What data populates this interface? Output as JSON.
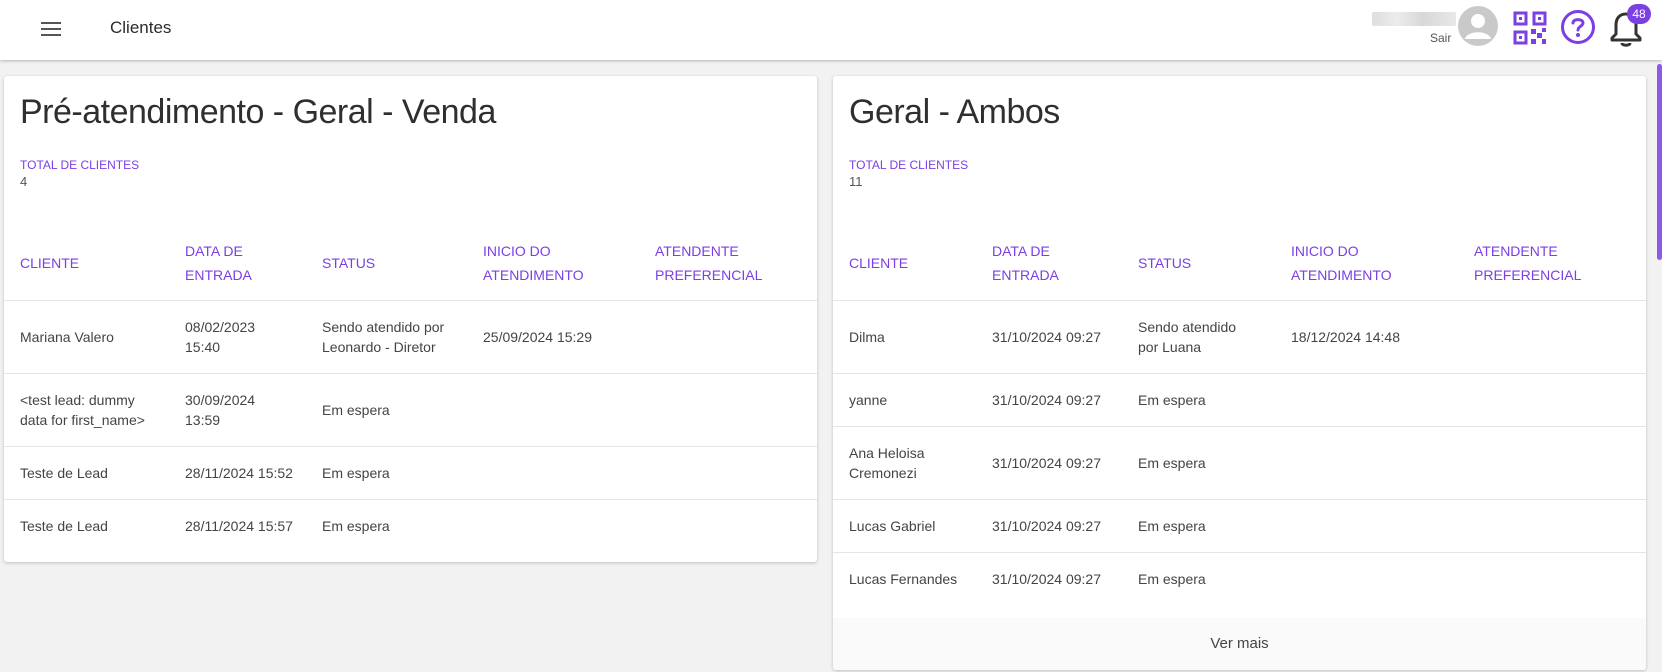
{
  "header": {
    "title": "Clientes",
    "logout": "Sair",
    "notification_count": "48",
    "accent_color": "#7b3fe4",
    "icons": [
      "menu-icon",
      "avatar-icon",
      "qr-code-icon",
      "help-icon",
      "bell-icon"
    ]
  },
  "left": {
    "title": "Pré-atendimento - Geral - Venda",
    "total_label": "TOTAL DE CLIENTES",
    "total_value": "4",
    "columns": [
      "CLIENTE",
      "DATA DE ENTRADA",
      "STATUS",
      "INICIO DO ATENDIMENTO",
      "ATENDENTE PREFERENCIAL"
    ],
    "rows": [
      {
        "cliente": "Mariana Valero",
        "data": "08/02/2023 15:40",
        "status": "Sendo atendido por Leonardo - Diretor",
        "inicio": "25/09/2024 15:29",
        "atendente": ""
      },
      {
        "cliente": "<test lead: dummy data for first_name>",
        "data": "30/09/2024 13:59",
        "status": "Em espera",
        "inicio": "",
        "atendente": ""
      },
      {
        "cliente": "Teste de Lead",
        "data": "28/11/2024 15:52",
        "status": "Em espera",
        "inicio": "",
        "atendente": ""
      },
      {
        "cliente": "Teste de Lead",
        "data": "28/11/2024 15:57",
        "status": "Em espera",
        "inicio": "",
        "atendente": ""
      }
    ]
  },
  "right": {
    "title": "Geral - Ambos",
    "total_label": "TOTAL DE CLIENTES",
    "total_value": "11",
    "columns": [
      "CLIENTE",
      "DATA DE ENTRADA",
      "STATUS",
      "INICIO DO ATENDIMENTO",
      "ATENDENTE PREFERENCIAL"
    ],
    "rows": [
      {
        "cliente": "Dilma",
        "data": "31/10/2024 09:27",
        "status": "Sendo atendido por Luana",
        "inicio": "18/12/2024 14:48",
        "atendente": ""
      },
      {
        "cliente": "yanne",
        "data": "31/10/2024 09:27",
        "status": "Em espera",
        "inicio": "",
        "atendente": ""
      },
      {
        "cliente": "Ana Heloisa Cremonezi",
        "data": "31/10/2024 09:27",
        "status": "Em espera",
        "inicio": "",
        "atendente": ""
      },
      {
        "cliente": "Lucas Gabriel",
        "data": "31/10/2024 09:27",
        "status": "Em espera",
        "inicio": "",
        "atendente": ""
      },
      {
        "cliente": "Lucas Fernandes",
        "data": "31/10/2024 09:27",
        "status": "Em espera",
        "inicio": "",
        "atendente": ""
      }
    ],
    "ver_mais": "Ver mais"
  }
}
